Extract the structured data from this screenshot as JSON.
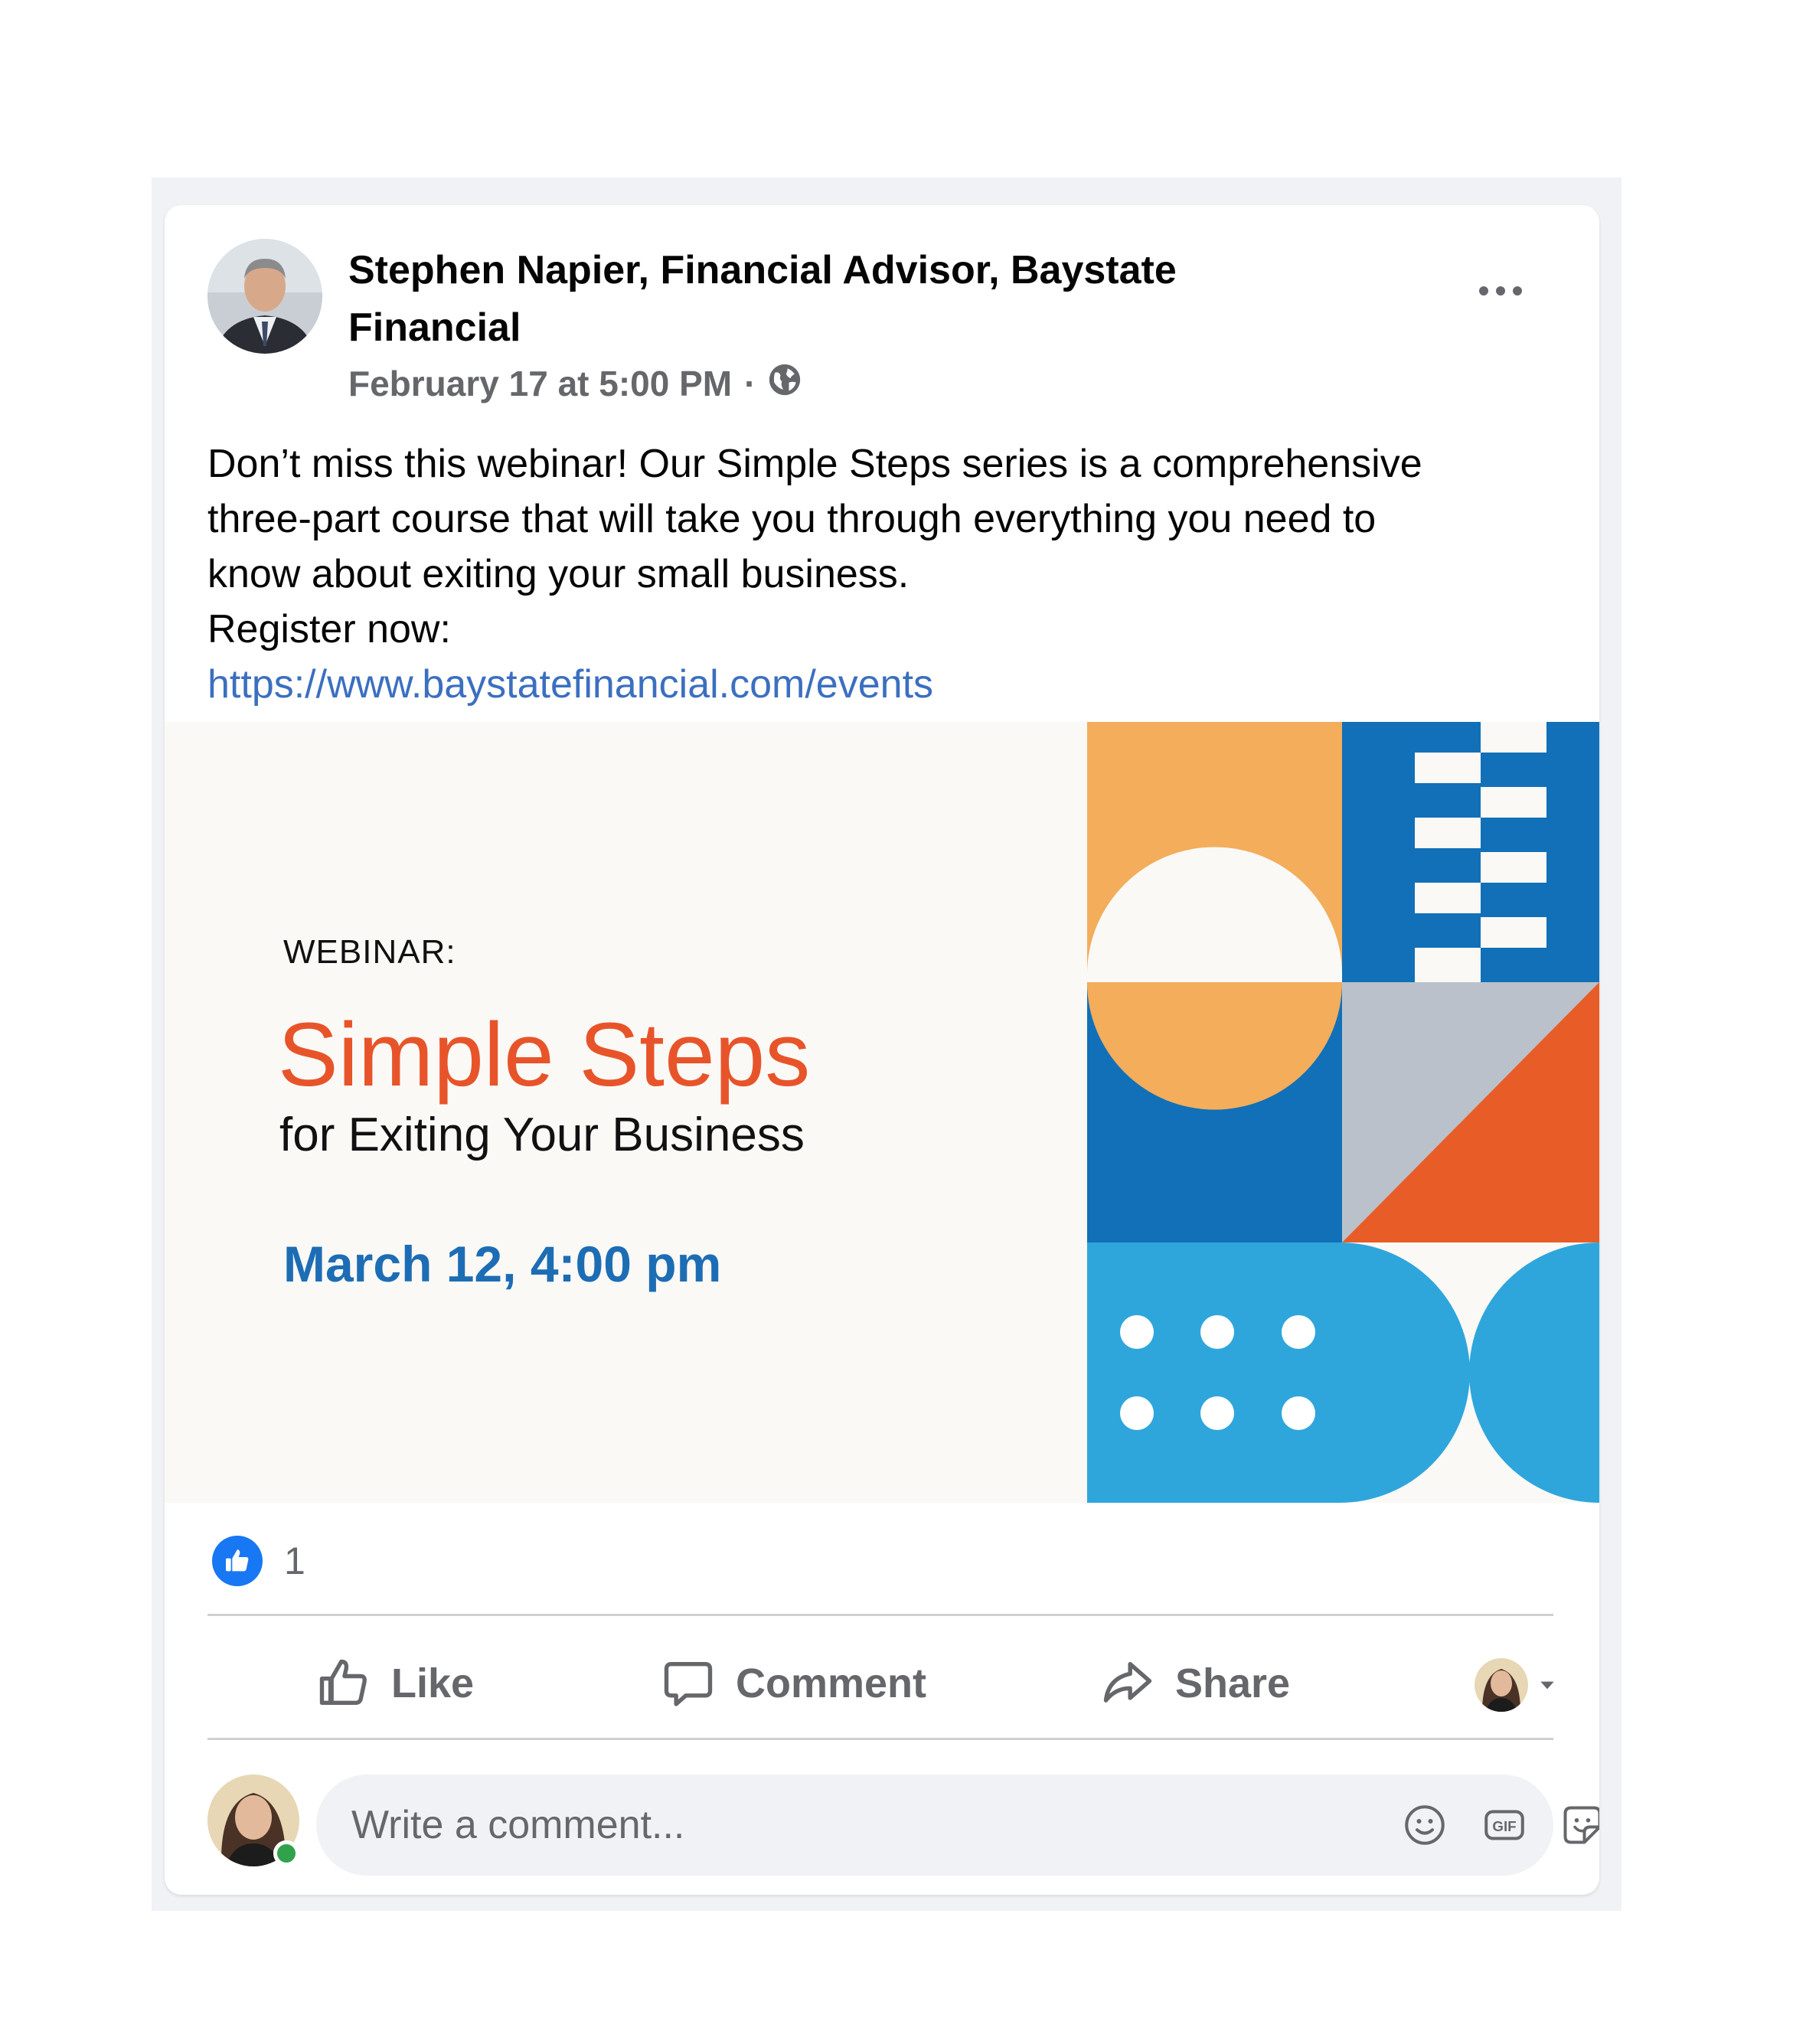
{
  "post": {
    "author": "Stephen Napier, Financial Advisor, Baystate Financial",
    "timestamp": "February 17 at 5:00 PM",
    "separator": "·",
    "privacy_icon": "globe-icon",
    "body_lines": [
      "Don’t miss this webinar! Our Simple Steps series is a comprehensive",
      "three-part course that will take you through everything you need to",
      "know about exiting your small business.",
      "Register now:"
    ],
    "link": "https://www.baystatefinancial.com/events"
  },
  "webinar": {
    "label": "WEBINAR:",
    "title": "Simple Steps",
    "subtitle": "for Exiting Your Business",
    "date": "March 12, 4:00 pm",
    "colors": {
      "background": "#faf9f6",
      "orange": "#f3ad5b",
      "dark_blue": "#1170b7",
      "light_blue": "#2ea6dc",
      "red_orange": "#e85d27",
      "gray": "#bbc1cb",
      "title_orange": "#e8542a",
      "date_blue": "#1d6db5"
    }
  },
  "reactions": {
    "icon": "thumbs-up-icon",
    "count": "1"
  },
  "actions": {
    "like": "Like",
    "comment": "Comment",
    "share": "Share"
  },
  "comment_box": {
    "placeholder": "Write a comment..."
  },
  "colors": {
    "accent": "#1877f2",
    "link": "#3b6fc0",
    "secondary_text": "#65676b",
    "online": "#31a24c"
  }
}
